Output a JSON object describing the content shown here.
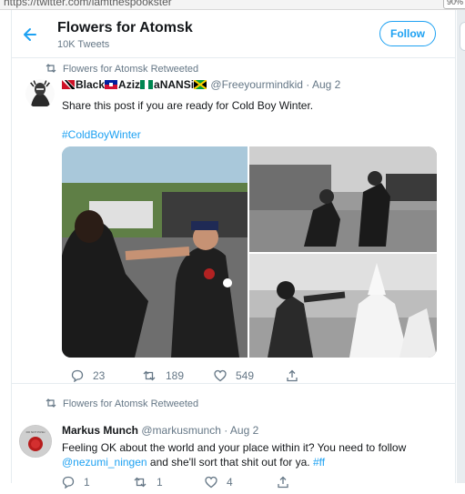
{
  "browser": {
    "url": "https://twitter.com/iamthespookster",
    "zoom": "90%"
  },
  "header": {
    "title": "Flowers for Atomsk",
    "tweet_count": "10K Tweets",
    "follow_label": "Follow"
  },
  "tweets": [
    {
      "retweet_label": "Flowers for Atomsk Retweeted",
      "author_name_parts": [
        "Black",
        "Aziz",
        "aNANSi"
      ],
      "handle": "@Freeyourmindkid",
      "separator": "·",
      "date": "Aug 2",
      "text": "Share this post if you are ready for Cold Boy Winter.",
      "hashtag": "#ColdBoyWinter",
      "replies": "23",
      "retweets": "189",
      "likes": "549"
    },
    {
      "retweet_label": "Flowers for Atomsk Retweeted",
      "author_name": "Markus Munch",
      "handle": "@markusmunch",
      "separator": "·",
      "date": "Aug 2",
      "text_line1": "Feeling OK about the world and your place within it? You need to follow",
      "mention": "@nezumi_ningen",
      "text_line2_rest": " and she'll sort that shit out for ya. ",
      "hashtag": "#ff",
      "avatar_text": "DO NOT PUSH",
      "replies": "1",
      "retweets": "1",
      "likes": "4"
    }
  ],
  "icons": {
    "back": "arrow-left-icon",
    "retweet": "retweet-icon",
    "reply": "reply-icon",
    "like": "heart-icon",
    "share": "share-icon"
  },
  "colors": {
    "accent": "#1da1f2",
    "secondary_text": "#657786",
    "border": "#e6ecf0"
  }
}
